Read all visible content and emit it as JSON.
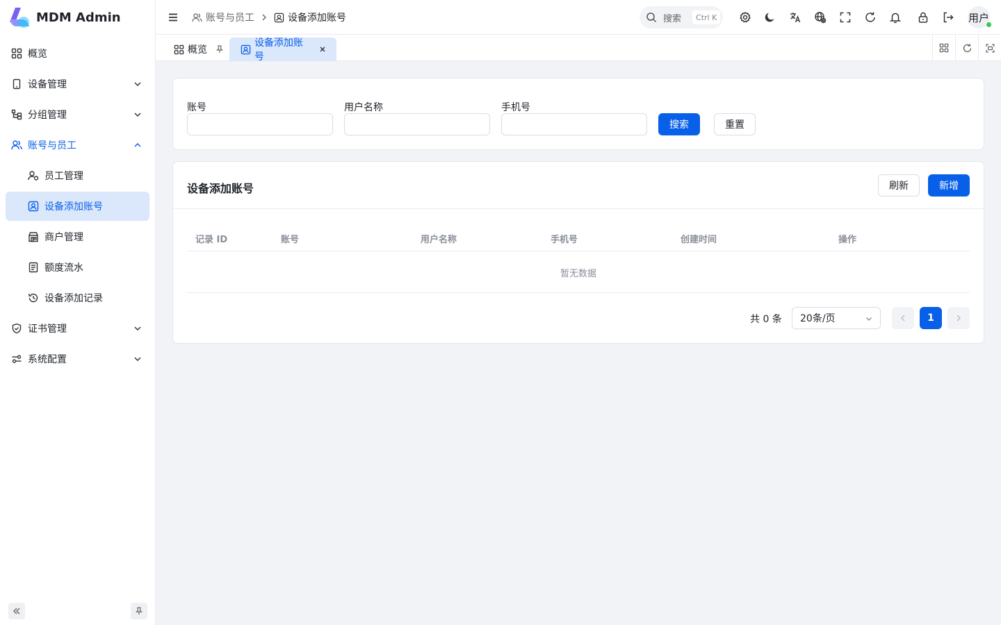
{
  "app": {
    "name": "MDM Admin"
  },
  "sidebar": {
    "items": [
      {
        "label": "概览",
        "icon": "dashboard-icon"
      },
      {
        "label": "设备管理",
        "icon": "device-icon"
      },
      {
        "label": "分组管理",
        "icon": "group-icon"
      },
      {
        "label": "账号与员工",
        "icon": "users-icon"
      },
      {
        "label": "员工管理",
        "icon": "user-icon"
      },
      {
        "label": "设备添加账号",
        "icon": "contact-icon"
      },
      {
        "label": "商户管理",
        "icon": "store-icon"
      },
      {
        "label": "额度流水",
        "icon": "receipt-icon"
      },
      {
        "label": "设备添加记录",
        "icon": "history-icon"
      },
      {
        "label": "证书管理",
        "icon": "shield-icon"
      },
      {
        "label": "系统配置",
        "icon": "settings-sliders-icon"
      }
    ]
  },
  "header": {
    "breadcrumb": [
      "账号与员工",
      "设备添加账号"
    ],
    "search": {
      "label": "搜索",
      "shortcut": "Ctrl K"
    },
    "user": "用户"
  },
  "tabs": [
    {
      "label": "概览"
    },
    {
      "label": "设备添加账号"
    }
  ],
  "filters": {
    "fields": [
      {
        "label": "账号",
        "value": "",
        "placeholder": ""
      },
      {
        "label": "用户名称",
        "value": "",
        "placeholder": ""
      },
      {
        "label": "手机号",
        "value": "",
        "placeholder": ""
      }
    ],
    "search_label": "搜索",
    "reset_label": "重置"
  },
  "table": {
    "title": "设备添加账号",
    "refresh_label": "刷新",
    "add_label": "新增",
    "columns": [
      "记录 ID",
      "账号",
      "用户名称",
      "手机号",
      "创建时间",
      "操作"
    ],
    "empty_text": "暂无数据",
    "rows": []
  },
  "pagination": {
    "total_text": "共 0 条",
    "page_size": "20条/页",
    "current_page": "1"
  },
  "colors": {
    "primary": "#0960e8",
    "active_bg": "#dbe7fb",
    "online": "#34c759"
  }
}
